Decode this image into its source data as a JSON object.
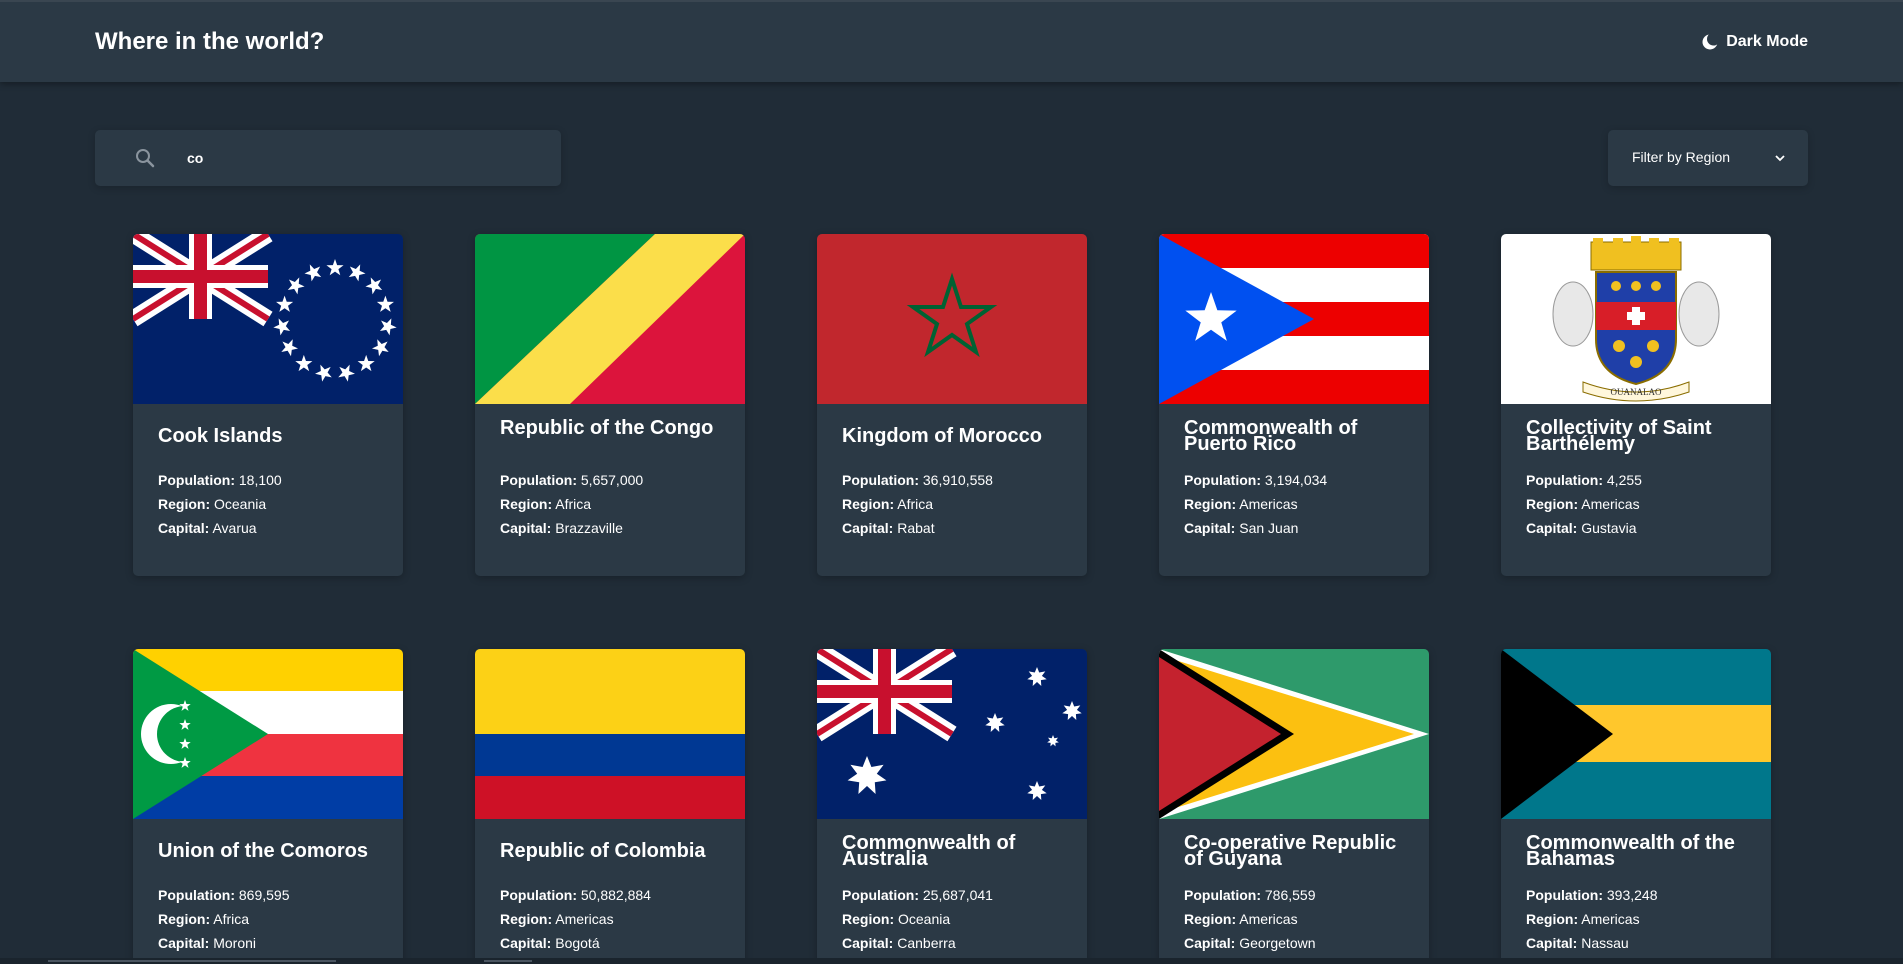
{
  "header": {
    "title": "Where in the world?",
    "mode_label": "Dark Mode",
    "mode_icon": "moon-icon"
  },
  "search": {
    "value": "co",
    "icon": "search-icon"
  },
  "filter": {
    "label": "Filter by Region",
    "icon": "chevron-down-icon"
  },
  "labels": {
    "population": "Population:",
    "region": "Region:",
    "capital": "Capital:"
  },
  "cards": [
    {
      "name": "Cook Islands",
      "population": "18,100",
      "region": "Oceania",
      "capital": "Avarua",
      "flag": "cook-islands-flag"
    },
    {
      "name": "Republic of the Congo",
      "population": "5,657,000",
      "region": "Africa",
      "capital": "Brazzaville",
      "flag": "congo-flag"
    },
    {
      "name": "Kingdom of Morocco",
      "population": "36,910,558",
      "region": "Africa",
      "capital": "Rabat",
      "flag": "morocco-flag"
    },
    {
      "name": "Commonwealth of Puerto Rico",
      "population": "3,194,034",
      "region": "Americas",
      "capital": "San Juan",
      "flag": "puerto-rico-flag"
    },
    {
      "name": "Collectivity of Saint Barthélemy",
      "population": "4,255",
      "region": "Americas",
      "capital": "Gustavia",
      "flag": "saint-barthelemy-flag",
      "flag_text": "OUANALAO"
    },
    {
      "name": "Union of the Comoros",
      "population": "869,595",
      "region": "Africa",
      "capital": "Moroni",
      "flag": "comoros-flag"
    },
    {
      "name": "Republic of Colombia",
      "population": "50,882,884",
      "region": "Americas",
      "capital": "Bogotá",
      "flag": "colombia-flag"
    },
    {
      "name": "Commonwealth of Australia",
      "population": "25,687,041",
      "region": "Oceania",
      "capital": "Canberra",
      "flag": "australia-flag"
    },
    {
      "name": "Co-operative Republic of Guyana",
      "population": "786,559",
      "region": "Americas",
      "capital": "Georgetown",
      "flag": "guyana-flag"
    },
    {
      "name": "Commonwealth of the Bahamas",
      "population": "393,248",
      "region": "Americas",
      "capital": "Nassau",
      "flag": "bahamas-flag"
    }
  ],
  "colors": {
    "background": "#202c37",
    "element": "#2b3945",
    "text": "#ffffff"
  }
}
